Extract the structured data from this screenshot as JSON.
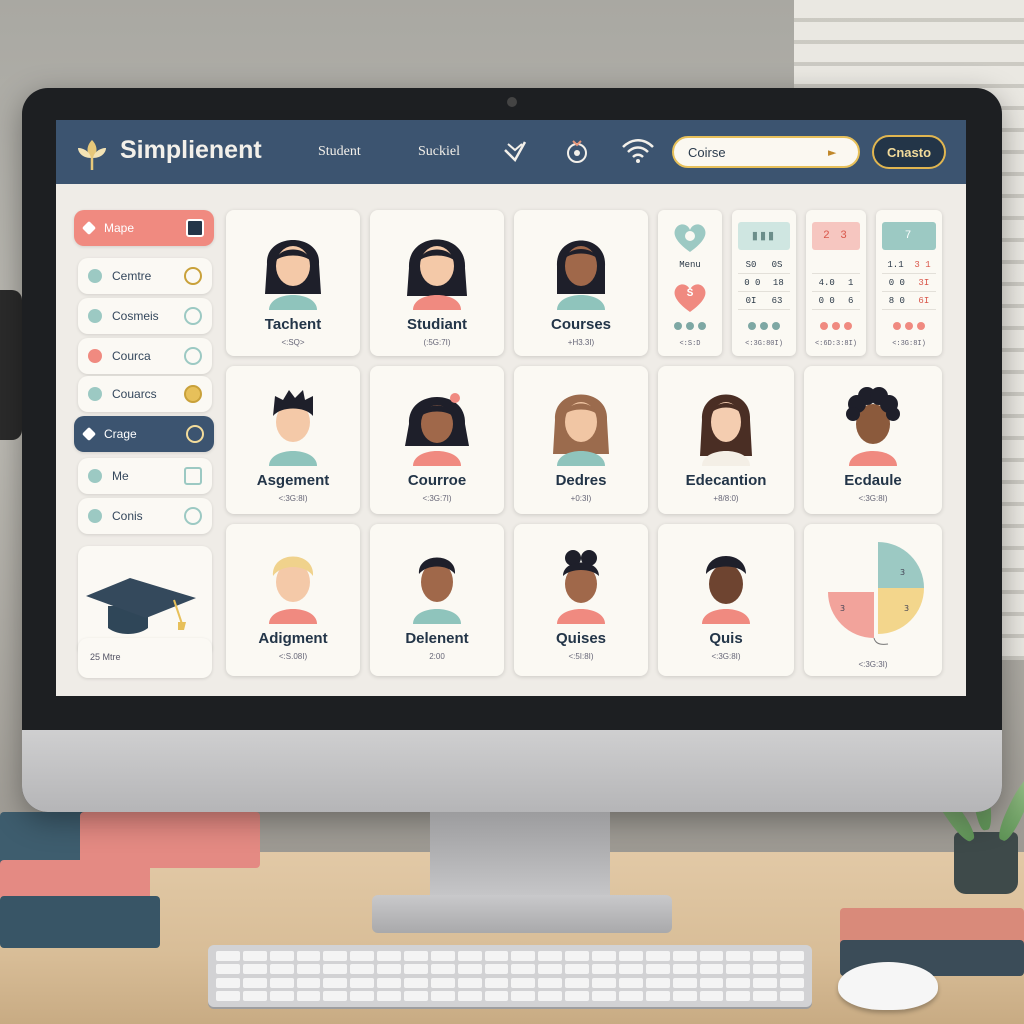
{
  "app": {
    "brand": "Simplienent"
  },
  "topbar": {
    "nav": [
      "Student",
      "Suckiel"
    ],
    "search_value": "Coirse",
    "button_label": "Cnasto"
  },
  "sidebar": {
    "items": [
      {
        "label": "Mape",
        "state": "active-pink"
      },
      {
        "label": "Cemtre"
      },
      {
        "label": "Cosmeis"
      },
      {
        "label": "Courca"
      },
      {
        "label": "Couarcs"
      },
      {
        "label": "Crage",
        "state": "active-dark"
      },
      {
        "label": "Me"
      },
      {
        "label": "Conis"
      }
    ],
    "footer": "25 Mtre"
  },
  "cards": [
    {
      "title": "Tachent",
      "sub": "<:SQ>"
    },
    {
      "title": "Studiant",
      "sub": "(:5G:7I)"
    },
    {
      "title": "Courses",
      "sub": "+H3.3I)"
    },
    {
      "title": "Asgement",
      "sub": "<:3G:8I)"
    },
    {
      "title": "Courroe",
      "sub": "<:3G:7I)"
    },
    {
      "title": "Dedres",
      "sub": "+0:3I)"
    },
    {
      "title": "Edecantion",
      "sub": "+8/8:0)"
    },
    {
      "title": "Ecdaule",
      "sub": "<:3G:8I)"
    },
    {
      "title": "Adigment",
      "sub": "<:S.08I)"
    },
    {
      "title": "Delenent",
      "sub": "2:00"
    },
    {
      "title": "Quises",
      "sub": "<:5I:8I)"
    },
    {
      "title": "Quis",
      "sub": "<:3G:8I)"
    }
  ],
  "widgets": {
    "menu_label": "Menu",
    "menu_badge": "S",
    "menu_foot": "<:S:D",
    "mini": [
      {
        "hdr": "",
        "rows": [
          [
            "S0",
            "0S"
          ],
          [
            "0 0",
            "18"
          ],
          [
            "0I",
            "63"
          ]
        ],
        "foot": "<:3G:80I)"
      },
      {
        "hdr": "2 3",
        "rows": [
          [
            "",
            ""
          ],
          [
            "4.0",
            "1"
          ],
          [
            "0 0",
            "6"
          ]
        ],
        "foot": "<:6D:3:8I)"
      },
      {
        "hdr": "7",
        "rows": [
          [
            "1.1",
            "3 1"
          ],
          [
            "0 0",
            "3I"
          ],
          [
            "8 0",
            "6I"
          ]
        ],
        "foot": "<:3G:8I)"
      }
    ],
    "pie_labels": [
      "3",
      "3",
      "3"
    ],
    "pie_foot": "<:3G:3I)"
  },
  "colors": {
    "topbar": "#3c5470",
    "accent_pink": "#f08a80",
    "accent_teal": "#9cc9c3",
    "accent_gold": "#e1b650"
  }
}
